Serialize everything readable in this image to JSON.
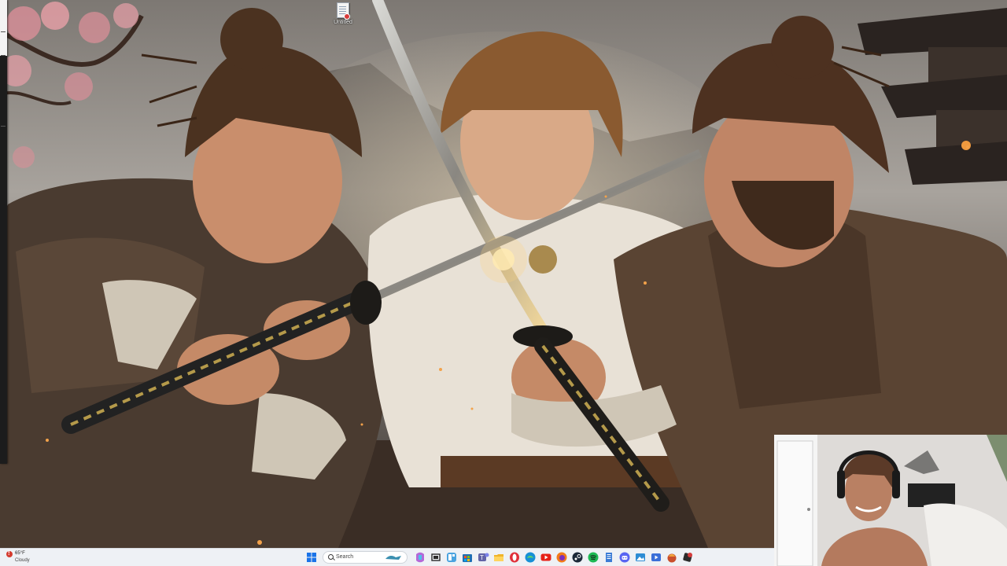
{
  "desktop": {
    "icons": [
      {
        "label": "Untitled",
        "icon": "text-document-icon"
      }
    ]
  },
  "taskbar": {
    "weather": {
      "temperature": "65°F",
      "condition": "Cloudy",
      "icon": "weather-alert-icon"
    },
    "search": {
      "placeholder": "Search"
    },
    "pinned_apps": [
      {
        "name": "windows-start-icon",
        "color": "#1a73e8"
      },
      {
        "name": "copilot-icon",
        "color": "#b46ad8"
      },
      {
        "name": "task-view-icon",
        "color": "#2b2b2b"
      },
      {
        "name": "widgets-icon",
        "color": "#4aa3df"
      },
      {
        "name": "store-icon",
        "color": "#1f6fb2"
      },
      {
        "name": "teams-icon",
        "color": "#6264a7"
      },
      {
        "name": "file-explorer-icon",
        "color": "#f0b429"
      },
      {
        "name": "opera-icon",
        "color": "#e0303a"
      },
      {
        "name": "edge-icon",
        "color": "#1690d6"
      },
      {
        "name": "youtube-icon",
        "color": "#e62117"
      },
      {
        "name": "firefox-icon",
        "color": "#f27a1a"
      },
      {
        "name": "steam-icon",
        "color": "#1b2838"
      },
      {
        "name": "spotify-icon",
        "color": "#1db954"
      },
      {
        "name": "notepad-icon",
        "color": "#3a7bd5"
      },
      {
        "name": "discord-icon",
        "color": "#5865f2"
      },
      {
        "name": "photos-icon",
        "color": "#2d8cd4"
      },
      {
        "name": "media-player-icon",
        "color": "#3a6fd8"
      },
      {
        "name": "game-launcher-icon",
        "color": "#c94f2c"
      },
      {
        "name": "roblox-studio-icon",
        "color": "#d43b3b"
      }
    ]
  },
  "overlays": {
    "webcam": {
      "name": "webcam-feed"
    }
  },
  "colors": {
    "taskbar_bg": "#eef1f5",
    "sky": "#8e8a86",
    "cherry_blossom": "#e8a0a8"
  }
}
